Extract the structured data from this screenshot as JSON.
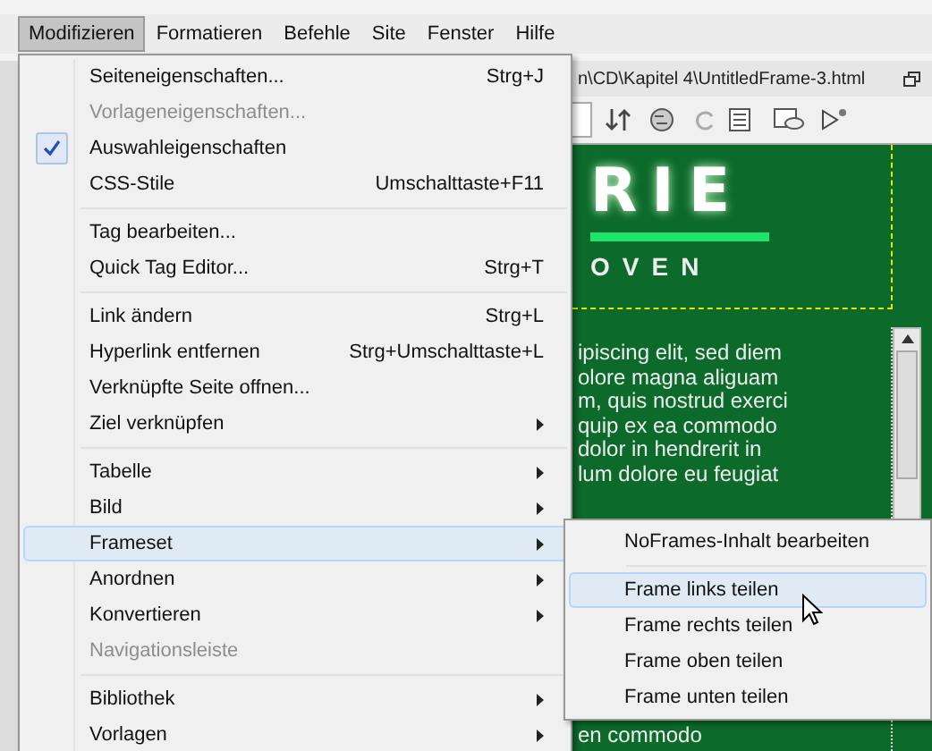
{
  "menubar": [
    {
      "label": "Modifizieren",
      "selected": true
    },
    {
      "label": "Formatieren",
      "selected": false
    },
    {
      "label": "Befehle",
      "selected": false
    },
    {
      "label": "Site",
      "selected": false
    },
    {
      "label": "Fenster",
      "selected": false
    },
    {
      "label": "Hilfe",
      "selected": false
    }
  ],
  "document": {
    "title": "n\\CD\\Kapitel 4\\UntitledFrame-3.html",
    "header_text": "RIE",
    "sub_text": "OVEN",
    "body_lines": [
      "ipiscing elit, sed diem",
      "olore magna aliguam",
      "m, quis nostrud exerci",
      "quip ex ea commodo",
      "dolor in hendrerit in",
      "lum dolore eu feugiat"
    ],
    "last_line": "en commodo"
  },
  "menu": {
    "items": [
      {
        "kind": "item",
        "label": "Seiteneigenschaften...",
        "shortcut": "Strg+J",
        "disabled": false,
        "checked": false,
        "submenu": false,
        "selected": false
      },
      {
        "kind": "item",
        "label": "Vorlageneigenschaften...",
        "disabled": true,
        "checked": false,
        "submenu": false,
        "selected": false
      },
      {
        "kind": "item",
        "label": "Auswahleigenschaften",
        "disabled": false,
        "checked": true,
        "submenu": false,
        "selected": false
      },
      {
        "kind": "item",
        "label": "CSS-Stile",
        "shortcut": "Umschalttaste+F11",
        "disabled": false,
        "checked": false,
        "submenu": false,
        "selected": false
      },
      {
        "kind": "separator"
      },
      {
        "kind": "item",
        "label": "Tag bearbeiten...",
        "disabled": false,
        "checked": false,
        "submenu": false,
        "selected": false
      },
      {
        "kind": "item",
        "label": "Quick Tag Editor...",
        "shortcut": "Strg+T",
        "disabled": false,
        "checked": false,
        "submenu": false,
        "selected": false
      },
      {
        "kind": "separator"
      },
      {
        "kind": "item",
        "label": "Link ändern",
        "shortcut": "Strg+L",
        "disabled": false,
        "checked": false,
        "submenu": false,
        "selected": false
      },
      {
        "kind": "item",
        "label": "Hyperlink entfernen",
        "shortcut": "Strg+Umschalttaste+L",
        "disabled": false,
        "checked": false,
        "submenu": false,
        "selected": false
      },
      {
        "kind": "item",
        "label": "Verknüpfte Seite offnen...",
        "disabled": false,
        "checked": false,
        "submenu": false,
        "selected": false
      },
      {
        "kind": "item",
        "label": "Ziel verknüpfen",
        "disabled": false,
        "checked": false,
        "submenu": true,
        "selected": false
      },
      {
        "kind": "separator"
      },
      {
        "kind": "item",
        "label": "Tabelle",
        "disabled": false,
        "checked": false,
        "submenu": true,
        "selected": false
      },
      {
        "kind": "item",
        "label": "Bild",
        "disabled": false,
        "checked": false,
        "submenu": true,
        "selected": false
      },
      {
        "kind": "item",
        "label": "Frameset",
        "disabled": false,
        "checked": false,
        "submenu": true,
        "selected": true
      },
      {
        "kind": "item",
        "label": "Anordnen",
        "disabled": false,
        "checked": false,
        "submenu": true,
        "selected": false
      },
      {
        "kind": "item",
        "label": "Konvertieren",
        "disabled": false,
        "checked": false,
        "submenu": true,
        "selected": false
      },
      {
        "kind": "item",
        "label": "Navigationsleiste",
        "disabled": true,
        "checked": false,
        "submenu": false,
        "selected": false
      },
      {
        "kind": "separator"
      },
      {
        "kind": "item",
        "label": "Bibliothek",
        "disabled": false,
        "checked": false,
        "submenu": true,
        "selected": false
      },
      {
        "kind": "item",
        "label": "Vorlagen",
        "disabled": false,
        "checked": false,
        "submenu": true,
        "selected": false
      }
    ]
  },
  "submenu": {
    "items": [
      {
        "kind": "item",
        "label": "NoFrames-Inhalt bearbeiten",
        "selected": false
      },
      {
        "kind": "separator"
      },
      {
        "kind": "item",
        "label": "Frame links teilen",
        "selected": true
      },
      {
        "kind": "item",
        "label": "Frame rechts teilen",
        "selected": false
      },
      {
        "kind": "item",
        "label": "Frame oben teilen",
        "selected": false
      },
      {
        "kind": "item",
        "label": "Frame unten teilen",
        "selected": false
      }
    ]
  }
}
